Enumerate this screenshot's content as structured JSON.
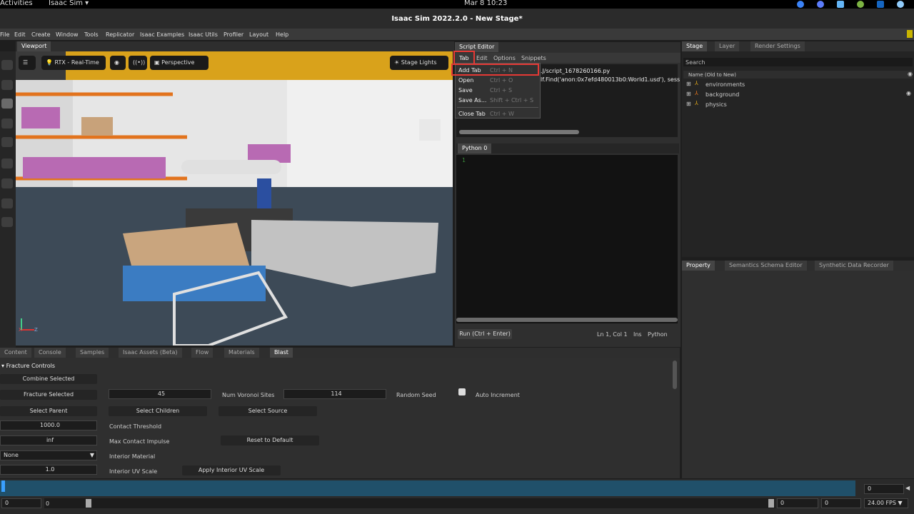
{
  "system_bar": {
    "activities": "Activities",
    "app_menu": "Isaac Sim ▾",
    "datetime": "Mar 8  10:23"
  },
  "window_title": "Isaac Sim 2022.2.0 - New Stage*",
  "menubar": [
    "File",
    "Edit",
    "Create",
    "Window",
    "Tools",
    "Replicator",
    "Isaac Examples",
    "Isaac Utils",
    "Profiler",
    "Layout",
    "Help"
  ],
  "viewport": {
    "tab": "Viewport",
    "render_mode": "RTX - Real-Time",
    "camera": "Perspective",
    "lights": "Stage Lights",
    "axis_x": "X",
    "axis_z": "Z"
  },
  "script_editor": {
    "title": "Script Editor",
    "menus": [
      "Tab",
      "Edit",
      "Options",
      "Snippets"
    ],
    "path_line": ".J/script_1678260166.py",
    "find_line": "lf.Find('anon:0x7efd480013b0:World1.usd'), sess",
    "python_tab": "Python 0",
    "line_number": "1",
    "run_button": "Run (Ctrl + Enter)",
    "cursor_pos": "Ln 1, Col 1",
    "mode": "Ins",
    "lang": "Python",
    "tab_menu": [
      {
        "label": "Add Tab",
        "shortcut": "Ctrl + N"
      },
      {
        "label": "Open",
        "shortcut": "Ctrl + O"
      },
      {
        "label": "Save",
        "shortcut": "Ctrl + S"
      },
      {
        "label": "Save As...",
        "shortcut": "Shift + Ctrl + S"
      },
      {
        "label": "Close Tab",
        "shortcut": "Ctrl + W"
      }
    ]
  },
  "stage": {
    "tabs": [
      "Stage",
      "Layer",
      "Render Settings"
    ],
    "search_placeholder": "Search",
    "column_header": "Name (Old to New)",
    "items": [
      "environments",
      "background",
      "physics"
    ]
  },
  "property": {
    "tabs": [
      "Property",
      "Semantics Schema Editor",
      "Synthetic Data Recorder"
    ]
  },
  "bottom": {
    "tabs": [
      "Content",
      "Console",
      "Samples",
      "Isaac Assets (Beta)",
      "Flow",
      "Materials",
      "Blast"
    ],
    "section": "Fracture Controls",
    "combine_selected": "Combine Selected",
    "fracture_selected": "Fracture Selected",
    "voronoi_value": "45",
    "voronoi_label": "Num Voronoi Sites",
    "seed_value": "114",
    "seed_label": "Random Seed",
    "auto_increment": "Auto Increment",
    "select_parent": "Select Parent",
    "select_children": "Select Children",
    "select_source": "Select Source",
    "contact_threshold_value": "1000.0",
    "contact_threshold_label": "Contact Threshold",
    "max_impulse_value": "inf",
    "max_impulse_label": "Max Contact Impulse",
    "reset_default": "Reset to Default",
    "interior_material_value": "None",
    "interior_material_label": "Interior Material",
    "uv_scale_value": "1.0",
    "uv_scale_label": "Interior UV Scale",
    "apply_uv": "Apply Interior UV Scale"
  },
  "timeline": {
    "start": "0",
    "start2": "0",
    "end": "0",
    "end2": "0",
    "current": "0",
    "fps": "24.00 FPS ▼"
  }
}
